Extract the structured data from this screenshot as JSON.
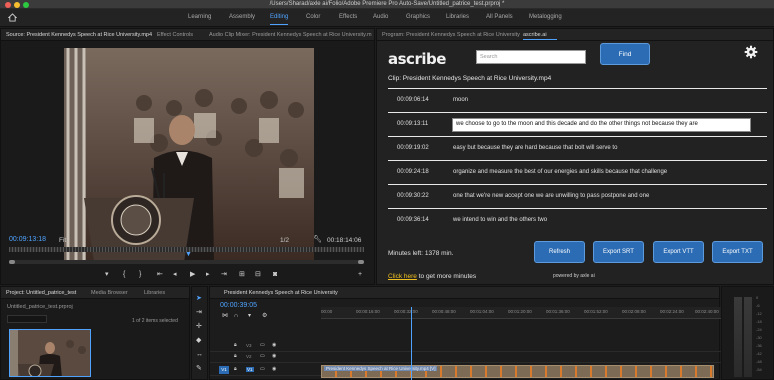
{
  "window": {
    "title": "/Users/Sharad/axle ai/Folio/Adobe Premiere Pro Auto-Save/Untitled_patrice_test.prproj *",
    "traffic_colors": [
      "#ee5f57",
      "#f6be2f",
      "#2cc840"
    ]
  },
  "workspaces": {
    "items": [
      "Learning",
      "Assembly",
      "Editing",
      "Color",
      "Effects",
      "Audio",
      "Graphics",
      "Libraries",
      "All Panels",
      "Metalogging"
    ],
    "active": "Editing",
    "accent": "#4fa3ff"
  },
  "source_panel": {
    "tabs": [
      "Source: President Kennedys Speech at Rice University.mp4",
      "Effect Controls",
      "Audio Clip Mixer: President Kennedys Speech at Rice University.m"
    ],
    "current_timecode": "00:09:13:18",
    "fit_label": "Fit",
    "resolution": "1/2",
    "duration_timecode": "00:18:14:06"
  },
  "ascribe": {
    "tabs": [
      "Program: President Kennedys Speech at Rice University",
      "ascribe.ai"
    ],
    "logo": "ascribe",
    "search_placeholder": "Search",
    "find_label": "Find",
    "clip_label": "Clip: President Kennedys Speech at Rice University.mp4",
    "transcript": [
      {
        "tc": "00:09:06:14",
        "text": "moon"
      },
      {
        "tc": "00:09:13:11",
        "text": "we choose to go to the moon and this decade and do the other things not because they are",
        "selected": true
      },
      {
        "tc": "00:09:19:02",
        "text": "easy but because they are hard because that bolt will serve to"
      },
      {
        "tc": "00:09:24:18",
        "text": "organize and measure the best of our energies and skills because that challenge"
      },
      {
        "tc": "00:09:30:22",
        "text": "one that we're new accept one we are unwilling to pass postpone and one"
      },
      {
        "tc": "00:09:36:14",
        "text": "we intend to win and the others two"
      }
    ],
    "minutes_left": "Minutes left: 1378 min.",
    "click_here": "Click here",
    "more_minutes": " to get more minutes",
    "buttons": [
      "Refresh",
      "Export SRT",
      "Export VTT",
      "Export TXT"
    ],
    "powered_by": "powered by axle ai",
    "button_color": "#2b6cb5",
    "link_color": "#f0c020"
  },
  "project_panel": {
    "tabs": [
      "Project: Untitled_patrice_test",
      "Media Browser",
      "Libraries"
    ],
    "path": "Untitled_patrice_test.prproj",
    "items_selected": "1 of 2 items selected"
  },
  "timeline": {
    "tab": "President Kennedys Speech at Rice University",
    "timecode": "00:00:39:05",
    "ruler": [
      "00:00",
      "00:00:16:00",
      "00:00:32:00",
      "00:00:48:00",
      "00:01:04:00",
      "00:01:20:00",
      "00:01:36:00",
      "00:01:52:00",
      "00:02:08:00",
      "00:02:24:00",
      "00:02:40:00"
    ],
    "tracks": [
      "V3",
      "V2",
      "V1"
    ],
    "clip_name": "President Kennedys Speech at Rice University.mp4 [V]"
  },
  "meters": {
    "db_labels": [
      "0",
      "-6",
      "-12",
      "-18",
      "-24",
      "-30",
      "-36",
      "-42",
      "-48",
      "-54"
    ]
  }
}
